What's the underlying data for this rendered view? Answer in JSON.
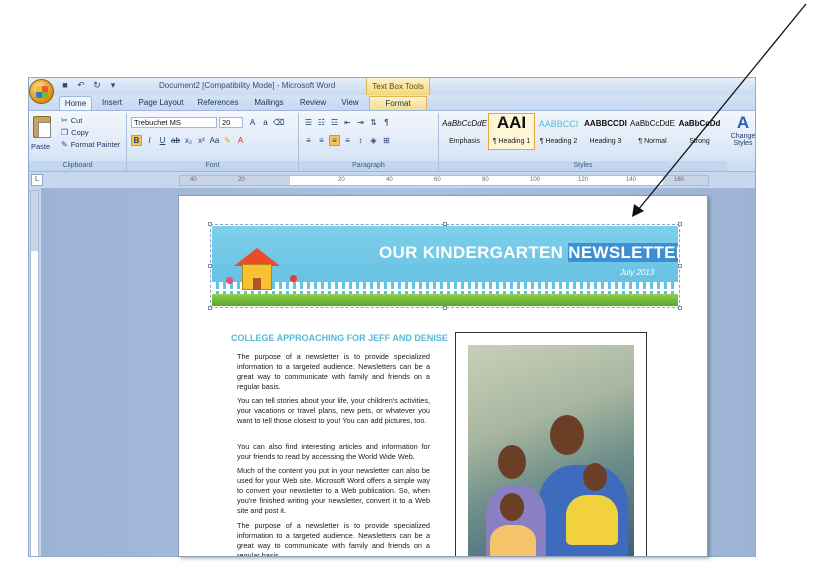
{
  "window": {
    "title": "Document2 [Compatibility Mode] - Microsoft Word",
    "contextual_tab_group": "Text Box Tools"
  },
  "ribbon_tabs": [
    {
      "label": "Home",
      "active": true
    },
    {
      "label": "Insert"
    },
    {
      "label": "Page Layout"
    },
    {
      "label": "References"
    },
    {
      "label": "Mailings"
    },
    {
      "label": "Review"
    },
    {
      "label": "View"
    },
    {
      "label": "Format",
      "contextual": true
    }
  ],
  "clipboard": {
    "label": "Clipboard",
    "paste": "Paste",
    "cut": "Cut",
    "copy": "Copy",
    "format_painter": "Format Painter"
  },
  "font": {
    "label": "Font",
    "family": "Trebuchet MS",
    "size": "20"
  },
  "paragraph": {
    "label": "Paragraph"
  },
  "styles": {
    "label": "Styles",
    "items": [
      {
        "sample": "AaBbCcDdE",
        "name": "Emphasis"
      },
      {
        "sample": "AAI",
        "name": "¶ Heading 1",
        "selected": true
      },
      {
        "sample": "AABBCCI",
        "name": "¶ Heading 2"
      },
      {
        "sample": "AABBCCDI",
        "name": "Heading 3"
      },
      {
        "sample": "AaBbCcDdE",
        "name": "¶ Normal"
      },
      {
        "sample": "AaBbCcDd",
        "name": "Strong"
      }
    ],
    "change_styles": "Change Styles"
  },
  "ruler": {
    "ticks": [
      "40",
      "20",
      "20",
      "40",
      "60",
      "80",
      "100",
      "120",
      "140",
      "160"
    ]
  },
  "document": {
    "banner_title_plain": "OUR KINDERGARTEN",
    "banner_title_selected": "NEWSLETTER",
    "banner_date": "July 2013",
    "article_title": "COLLEGE APPROACHING FOR JEFF AND DENISE",
    "paragraphs": [
      "The purpose of a newsletter is to provide specialized information to a targeted audience. Newsletters can be a great way to communicate with family and friends on a regular basis.",
      "You can tell stories about your life, your children's activities, your vacations or travel plans, new pets, or whatever you want to tell those closest to you! You can add pictures, too.",
      "You can also find interesting articles and information for your friends to read by accessing the World Wide Web.",
      "Much of the content you put in your newsletter can also be used for your Web site. Microsoft Word offers a simple way to convert your newsletter to a Web publication. So, when you're finished writing your newsletter, convert it to a Web site and post it.",
      "The purpose of a newsletter is to provide specialized information to a targeted audience. Newsletters can be a great way to communicate with family and friends on a regular basis."
    ]
  },
  "colors": {
    "ribbon_bg": "#dbe7f6",
    "banner_sky": "#6cc5e6",
    "article_title": "#59b7da",
    "selection_highlight": "#3c8fd4",
    "contextual_tab": "#f6dd90"
  }
}
